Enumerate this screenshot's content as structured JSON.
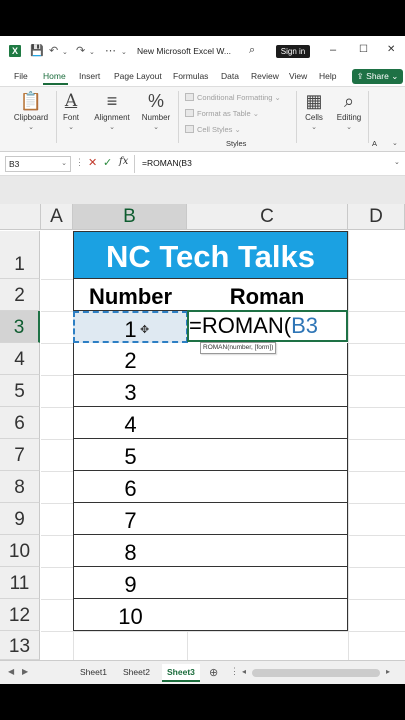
{
  "titlebar": {
    "app_icon": "X",
    "doc_title": "New Microsoft Excel W...",
    "search_icon": "search-icon",
    "sign_in": "Sign in",
    "minimize": "–",
    "restore": "☐",
    "close": "✕"
  },
  "menu": {
    "tabs": [
      "File",
      "Home",
      "Insert",
      "Page Layout",
      "Formulas",
      "Data",
      "Review",
      "View",
      "Help"
    ],
    "share": "Share"
  },
  "ribbon": {
    "clipboard": "Clipboard",
    "font": "Font",
    "alignment": "Alignment",
    "number": "Number",
    "conditional_formatting": "Conditional Formatting",
    "format_as_table": "Format as Table",
    "cell_styles": "Cell Styles",
    "styles_group": "Styles",
    "cells": "Cells",
    "editing": "Editing",
    "a_group": "A"
  },
  "formula_bar": {
    "name_box": "B3",
    "formula": "=ROMAN(B3"
  },
  "columns": [
    "A",
    "B",
    "C",
    "D"
  ],
  "rows": [
    "1",
    "2",
    "3",
    "4",
    "5",
    "6",
    "7",
    "8",
    "9",
    "10",
    "11",
    "12",
    "13"
  ],
  "sheet": {
    "title": "NC Tech Talks",
    "header_number": "Number",
    "header_roman": "Roman",
    "numbers": [
      "1",
      "2",
      "3",
      "4",
      "5",
      "6",
      "7",
      "8",
      "9",
      "10"
    ],
    "formula_prefix": "=ROMAN(",
    "formula_ref": "B3",
    "tooltip": "ROMAN(number, [form])"
  },
  "sheet_tabs": [
    "Sheet1",
    "Sheet2",
    "Sheet3"
  ],
  "active_sheet": "Sheet3",
  "colors": {
    "excel_green": "#1e7145",
    "title_fill": "#1ba1e2",
    "reference_blue": "#2e75b6"
  }
}
